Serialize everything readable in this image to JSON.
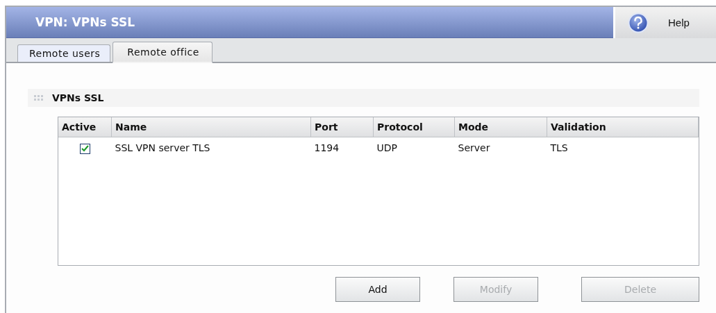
{
  "window": {
    "title": "VPN: VPNs SSL",
    "help": "Help"
  },
  "tabs": [
    {
      "label": "Remote users",
      "selected": false
    },
    {
      "label": "Remote office",
      "selected": true
    }
  ],
  "section": {
    "title": "VPNs SSL"
  },
  "table": {
    "columns": [
      "Active",
      "Name",
      "Port",
      "Protocol",
      "Mode",
      "Validation"
    ],
    "rows": [
      {
        "cells": [
          {
            "kind": "checkbox",
            "checked": true
          },
          "SSL VPN server TLS",
          "1194",
          "UDP",
          "Server",
          "TLS"
        ]
      }
    ]
  },
  "buttons": [
    {
      "label": "Add",
      "disabled": false
    },
    {
      "label": "Modify",
      "disabled": true
    },
    {
      "label": "Delete",
      "disabled": true
    }
  ]
}
